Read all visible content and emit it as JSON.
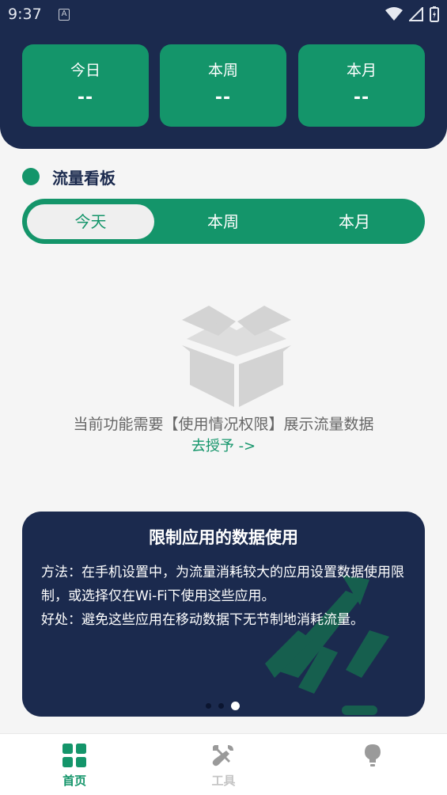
{
  "status_bar": {
    "time": "9:37",
    "badge": "A"
  },
  "header": {
    "cards": [
      {
        "label": "今日",
        "value": "--"
      },
      {
        "label": "本周",
        "value": "--"
      },
      {
        "label": "本月",
        "value": "--"
      }
    ]
  },
  "dashboard": {
    "title": "流量看板",
    "tabs": [
      {
        "label": "今天",
        "active": true
      },
      {
        "label": "本周",
        "active": false
      },
      {
        "label": "本月",
        "active": false
      }
    ],
    "empty_message": "当前功能需要【使用情况权限】展示流量数据",
    "grant_link": "去授予 ->"
  },
  "tip_card": {
    "title": "限制应用的数据使用",
    "line1": "方法：在手机设置中，为流量消耗较大的应用设置数据使用限制，或选择仅在Wi-Fi下使用这些应用。",
    "line2": "好处：避免这些应用在移动数据下无节制地消耗流量。",
    "page_count": 3,
    "active_page": 3
  },
  "bottom_nav": {
    "tabs": [
      {
        "label": "首页",
        "icon": "grid-icon",
        "active": true
      },
      {
        "label": "工具",
        "icon": "tools-icon",
        "active": false
      },
      {
        "label": "",
        "icon": "lightbulb-icon",
        "active": false
      }
    ]
  },
  "colors": {
    "navy": "#1b2a4e",
    "green": "#14956a",
    "background": "#f5f5f5"
  }
}
